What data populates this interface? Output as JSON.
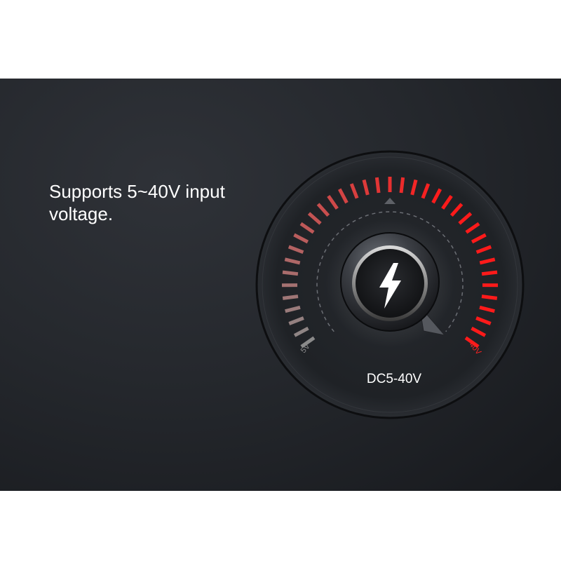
{
  "headline": "Supports 5~40V input voltage.",
  "dial": {
    "min_label": "5V",
    "max_label": "40V",
    "center_label": "DC5-40V",
    "icon": "lightning-bolt-icon",
    "tick_count": 37,
    "colors": {
      "tick_start": "#8a8a8a",
      "tick_end": "#ff1a1a",
      "min_label": "#8a8a8a",
      "max_label": "#ff2222",
      "center_label": "#ffffff"
    }
  }
}
